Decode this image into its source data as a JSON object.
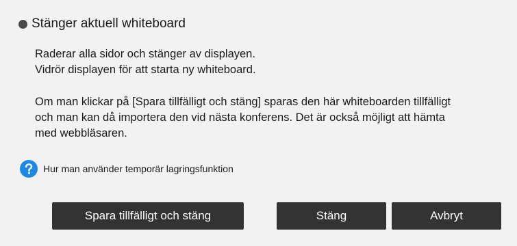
{
  "dialog": {
    "title": "Stänger aktuell whiteboard",
    "paragraph1": [
      "Raderar alla sidor och stänger av displayen.",
      "Vidrör displayen för att starta ny whiteboard."
    ],
    "paragraph2": [
      "Om man klickar på [Spara tillfälligt och stäng] sparas den här whiteboarden tillfälligt",
      "och man kan då importera den vid nästa konferens. Det är också möjligt att hämta",
      "med webbläsaren."
    ],
    "help": {
      "icon": "question-mark-icon",
      "label": "Hur man använder temporär lagringsfunktion"
    },
    "buttons": {
      "save_close": "Spara tillfälligt och stäng",
      "close": "Stäng",
      "cancel": "Avbryt"
    }
  },
  "colors": {
    "background": "#f2f2f2",
    "button_bg": "#333333",
    "button_text": "#ffffff",
    "help_icon": "#1e88e5",
    "bullet": "#4a4a4a"
  }
}
